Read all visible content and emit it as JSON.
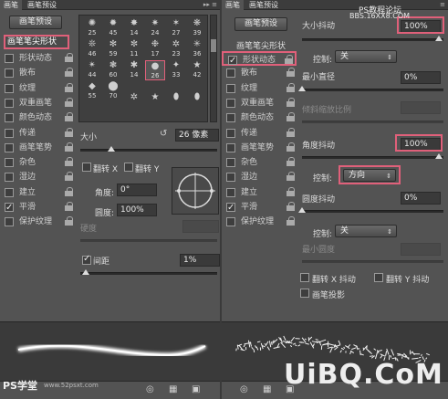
{
  "left": {
    "tabs": [
      "画笔",
      "画笔预设"
    ],
    "preset_button": "画笔预设",
    "brush_tip_title": "画笔笔尖形状",
    "options": [
      {
        "label": "形状动态",
        "checked": false
      },
      {
        "label": "散布",
        "checked": false
      },
      {
        "label": "纹理",
        "checked": false
      },
      {
        "label": "双重画笔",
        "checked": false
      },
      {
        "label": "颜色动态",
        "checked": false
      },
      {
        "label": "传递",
        "checked": false
      },
      {
        "label": "画笔笔势",
        "checked": false
      },
      {
        "label": "杂色",
        "checked": false
      },
      {
        "label": "湿边",
        "checked": false
      },
      {
        "label": "建立",
        "checked": false
      },
      {
        "label": "平滑",
        "checked": true
      },
      {
        "label": "保护纹理",
        "checked": false
      }
    ],
    "brush_sizes": [
      "25",
      "45",
      "14",
      "24",
      "27",
      "39",
      "46",
      "59",
      "11",
      "17",
      "23",
      "36",
      "44",
      "60",
      "14",
      "26",
      "33",
      "42",
      "55",
      "70"
    ],
    "size_label": "大小",
    "size_value": "26 像素",
    "flip_x": "翻转 X",
    "flip_y": "翻转 Y",
    "angle_label": "角度:",
    "angle_value": "0°",
    "roundness_label": "圆度:",
    "roundness_value": "100%",
    "hardness_label": "硬度",
    "spacing_label": "间距",
    "spacing_value": "1%",
    "watermark": "PS学堂",
    "watermark_url": "www.52psxt.com"
  },
  "right": {
    "tabs": [
      "画笔",
      "画笔预设"
    ],
    "preset_button": "画笔预设",
    "brush_tip_title": "画笔笔尖形状",
    "options": [
      {
        "label": "形状动态",
        "checked": true
      },
      {
        "label": "散布",
        "checked": false
      },
      {
        "label": "纹理",
        "checked": false
      },
      {
        "label": "双重画笔",
        "checked": false
      },
      {
        "label": "颜色动态",
        "checked": false
      },
      {
        "label": "传递",
        "checked": false
      },
      {
        "label": "画笔笔势",
        "checked": false
      },
      {
        "label": "杂色",
        "checked": false
      },
      {
        "label": "湿边",
        "checked": false
      },
      {
        "label": "建立",
        "checked": false
      },
      {
        "label": "平滑",
        "checked": true
      },
      {
        "label": "保护纹理",
        "checked": false
      }
    ],
    "size_jitter_label": "大小抖动",
    "size_jitter_value": "100%",
    "control_label": "控制:",
    "control1_value": "关",
    "min_diameter_label": "最小直径",
    "min_diameter_value": "0%",
    "tilt_scale_label": "倾斜缩放比例",
    "angle_jitter_label": "角度抖动",
    "angle_jitter_value": "100%",
    "control2_value": "方向",
    "roundness_jitter_label": "圆度抖动",
    "roundness_jitter_value": "0%",
    "control3_value": "关",
    "min_roundness_label": "最小圆度",
    "flip_x_jitter": "翻转 X 抖动",
    "flip_y_jitter": "翻转 Y 抖动",
    "brush_projection": "画笔投影",
    "watermark_top": "PS教程论坛",
    "watermark_url": "BBS.16XX8.COM",
    "logo": "UiBQ.CoM"
  },
  "colors": {
    "highlight": "#e0607a",
    "panel": "#535353",
    "dark": "#3a3a3a"
  }
}
